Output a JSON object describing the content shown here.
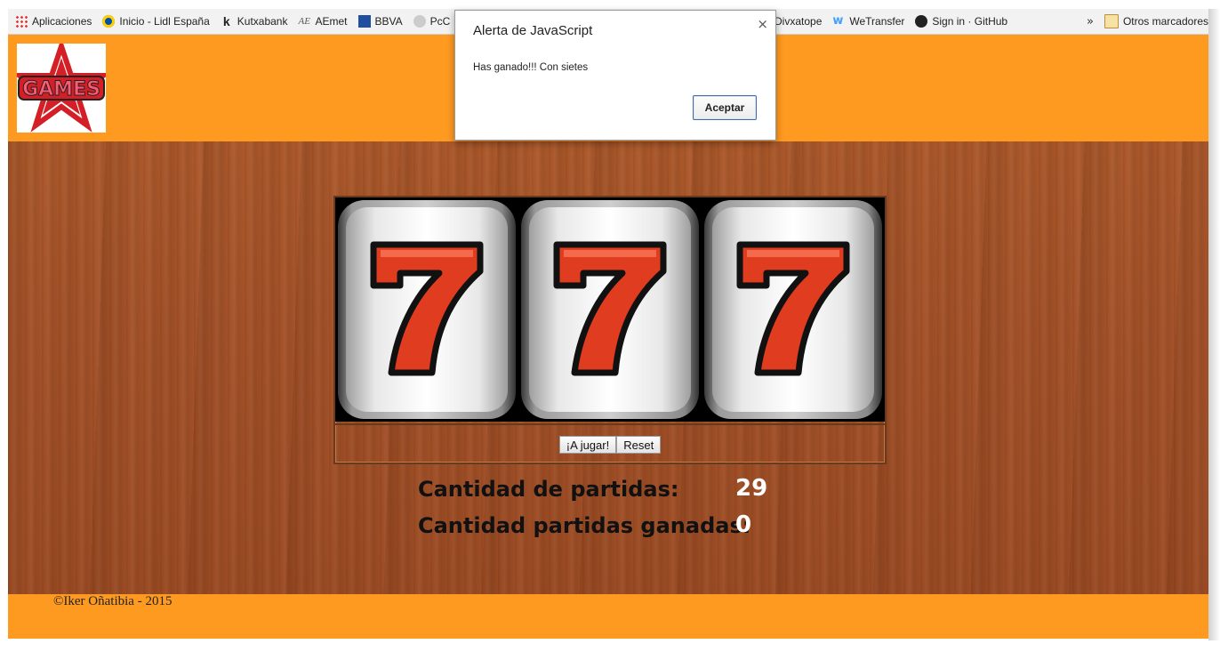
{
  "bookmarks": {
    "items": [
      {
        "label": "Aplicaciones",
        "icon": "apps-grid-icon"
      },
      {
        "label": "Inicio - Lidl España",
        "icon": "lidl-icon"
      },
      {
        "label": "Kutxabank",
        "icon": "kutxabank-icon"
      },
      {
        "label": "AEmet",
        "icon": "aemet-icon"
      },
      {
        "label": "BBVA",
        "icon": "bbva-icon"
      },
      {
        "label": "PcC",
        "icon": "pc-icon"
      }
    ],
    "items_after_dialog": [
      {
        "label": "Divxatope",
        "icon": ""
      },
      {
        "label": "WeTransfer",
        "icon": "wetransfer-icon"
      },
      {
        "label": "Sign in · GitHub",
        "icon": "github-icon"
      }
    ],
    "overflow": "»",
    "other": "Otros marcadores"
  },
  "header": {
    "logo_text": "GAMES"
  },
  "slot": {
    "reels": [
      "7",
      "7",
      "7"
    ],
    "play_button": "¡A jugar!",
    "reset_button": "Reset"
  },
  "stats": {
    "games_label": "Cantidad de partidas:",
    "games_value": "29",
    "wins_label": "Cantidad partidas ganadas:",
    "wins_value": "0"
  },
  "footer": {
    "copyright": "©Iker Oñatibia - 2015"
  },
  "dialog": {
    "title": "Alerta de JavaScript",
    "close": "×",
    "message": "Has ganado!!! Con sietes",
    "ok_button": "Aceptar"
  },
  "colors": {
    "orange": "#ff9a20",
    "wood": "#a5532a",
    "seven_red": "#e03c1f"
  }
}
